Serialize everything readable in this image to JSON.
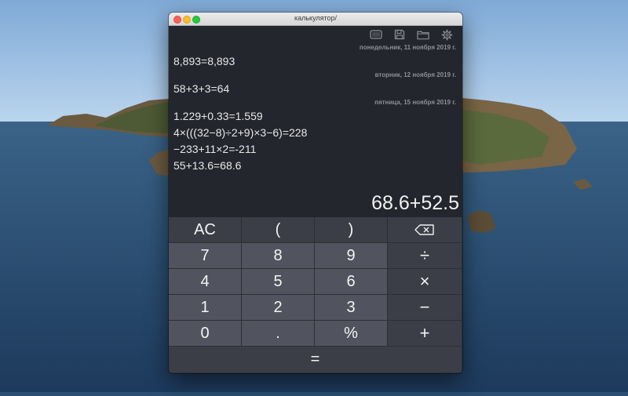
{
  "window": {
    "title": "калькулятор/"
  },
  "toolbar": {
    "icons": [
      "window-icon",
      "save-icon",
      "folder-icon",
      "gear-icon"
    ]
  },
  "history": [
    {
      "date": "понедельник, 11 ноября 2019 г.",
      "entries": [
        "8,893=8,893"
      ]
    },
    {
      "date": "вторник, 12 ноября 2019 г.",
      "entries": [
        "58+3+3=64"
      ]
    },
    {
      "date": "пятница, 15 ноября 2019 г.",
      "entries": [
        "1.229+0.33=1.559",
        "4×(((32−8)÷2+9)×3−6)=228",
        "−233+11×2=-211",
        "55+13.6=68.6"
      ]
    }
  ],
  "display": {
    "expression": "68.6+52.5"
  },
  "keys": {
    "ac": "AC",
    "lparen": "(",
    "rparen": ")",
    "d7": "7",
    "d8": "8",
    "d9": "9",
    "div": "÷",
    "d4": "4",
    "d5": "5",
    "d6": "6",
    "mul": "×",
    "d1": "1",
    "d2": "2",
    "d3": "3",
    "sub": "−",
    "d0": "0",
    "dot": ".",
    "pct": "%",
    "add": "+",
    "eq": "="
  },
  "colors": {
    "window_bg": "#24262d",
    "key_dark": "#3b3e47",
    "key_light": "#51545e",
    "desktop_sky": "#9cc1e4",
    "desktop_sea": "#284b70"
  }
}
